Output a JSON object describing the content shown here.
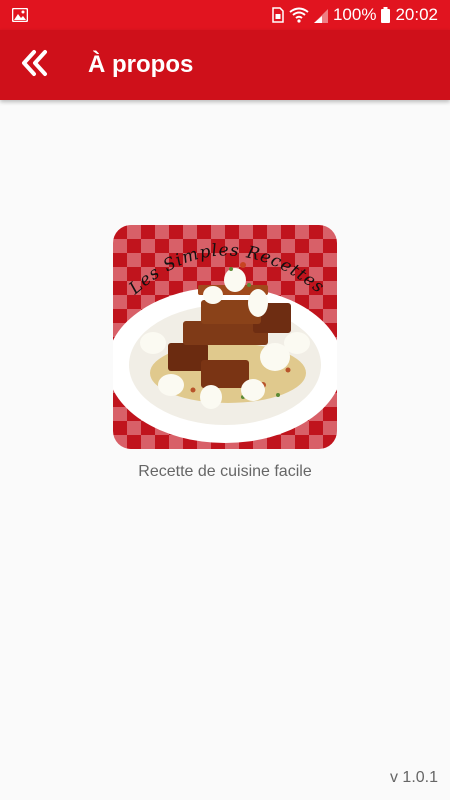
{
  "status_bar": {
    "battery": "100%",
    "time": "20:02",
    "icons": [
      "image-icon",
      "sim-icon",
      "wifi-icon",
      "signal-icon",
      "battery-icon"
    ]
  },
  "app_bar": {
    "title": "À propos",
    "back_icon": "double-chevron-left-icon"
  },
  "logo": {
    "text": "Les Simples Recettes"
  },
  "tagline": "Recette de cuisine facile",
  "version": "v 1.0.1",
  "colors": {
    "status_bar": "#e1141f",
    "app_bar": "#cf101a",
    "background": "#fafafa",
    "secondary_text": "#666666"
  }
}
